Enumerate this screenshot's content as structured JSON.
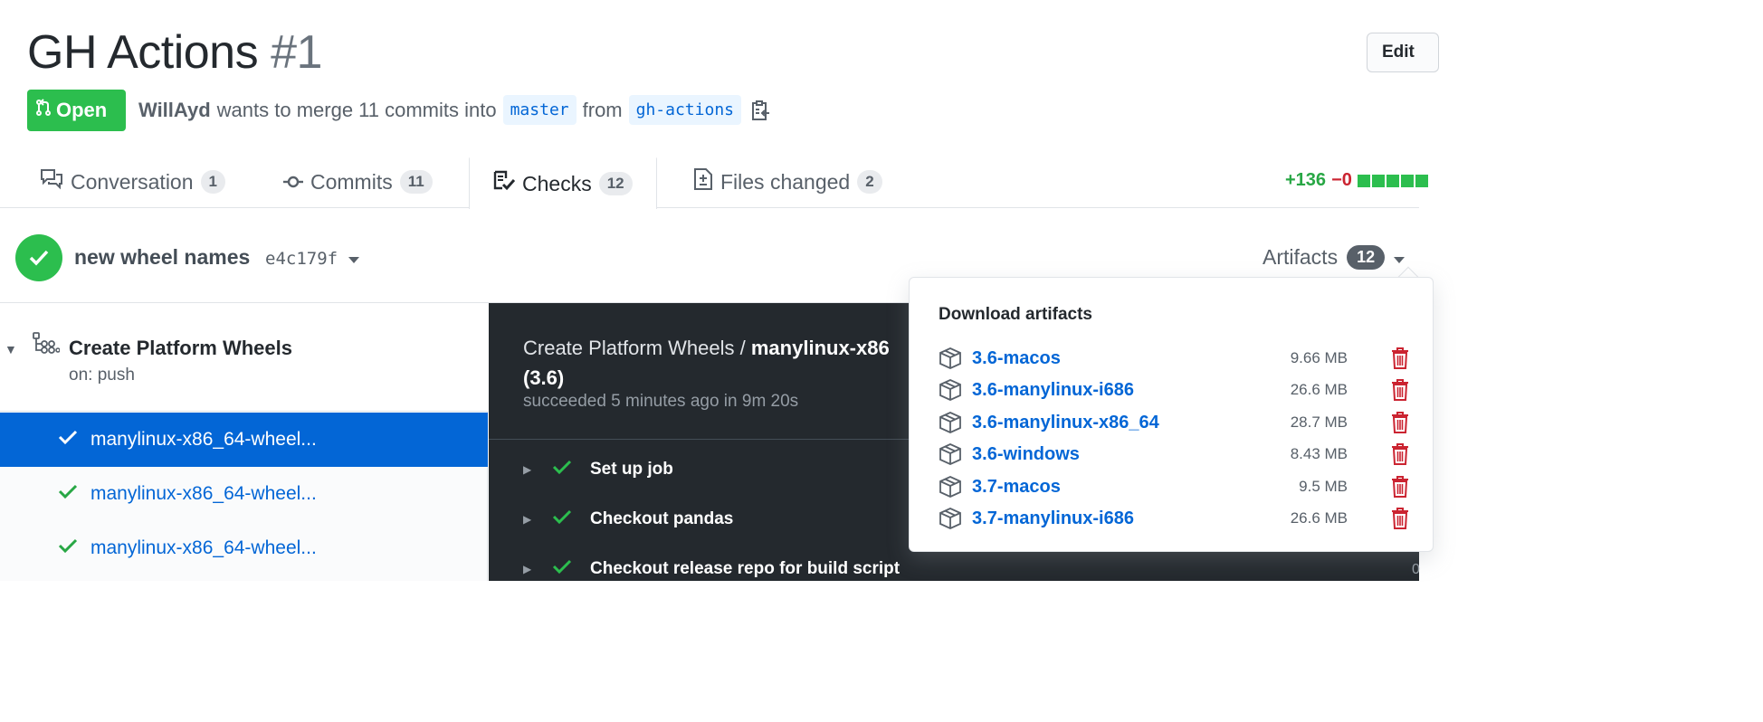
{
  "pr": {
    "title": "GH Actions",
    "number": "#1",
    "edit_label": "Edit",
    "state": "Open",
    "author": "WillAyd",
    "merge_text": "wants to merge 11 commits into",
    "base_branch": "master",
    "from_text": "from",
    "head_branch": "gh-actions"
  },
  "tabs": [
    {
      "label": "Conversation",
      "count": "1",
      "icon": "comment-discussion-icon"
    },
    {
      "label": "Commits",
      "count": "11",
      "icon": "git-commit-icon"
    },
    {
      "label": "Checks",
      "count": "12",
      "icon": "checklist-icon",
      "selected": true
    },
    {
      "label": "Files changed",
      "count": "2",
      "icon": "file-diff-icon"
    }
  ],
  "diffstat": {
    "additions": "+136",
    "deletions": "−0"
  },
  "suite": {
    "commit_message": "new wheel names",
    "sha": "e4c179f",
    "artifacts_label": "Artifacts",
    "artifacts_count": "12"
  },
  "workflow": {
    "name": "Create Platform Wheels",
    "trigger": "on: push"
  },
  "jobs": [
    {
      "label": "manylinux-x86_64-wheel...",
      "selected": true
    },
    {
      "label": "manylinux-x86_64-wheel..."
    },
    {
      "label": "manylinux-x86_64-wheel..."
    }
  ],
  "log": {
    "title_prefix": "Create Platform Wheels / ",
    "title_job": "manylinux-x86",
    "title_line2": "(3.6)",
    "status": "succeeded 5 minutes ago in 9m 20s",
    "steps": [
      "Set up job",
      "Checkout pandas",
      "Checkout release repo for build script"
    ],
    "partial_time": "0"
  },
  "artifacts_popover": {
    "title": "Download artifacts",
    "items": [
      {
        "name": "3.6-macos",
        "size": "9.66 MB"
      },
      {
        "name": "3.6-manylinux-i686",
        "size": "26.6 MB"
      },
      {
        "name": "3.6-manylinux-x86_64",
        "size": "28.7 MB"
      },
      {
        "name": "3.6-windows",
        "size": "8.43 MB"
      },
      {
        "name": "3.7-macos",
        "size": "9.5 MB"
      },
      {
        "name": "3.7-manylinux-i686",
        "size": "26.6 MB"
      }
    ]
  },
  "colors": {
    "success": "#2cbe4e",
    "link": "#0366d6",
    "danger": "#cb2431",
    "log_bg": "#24292e"
  }
}
